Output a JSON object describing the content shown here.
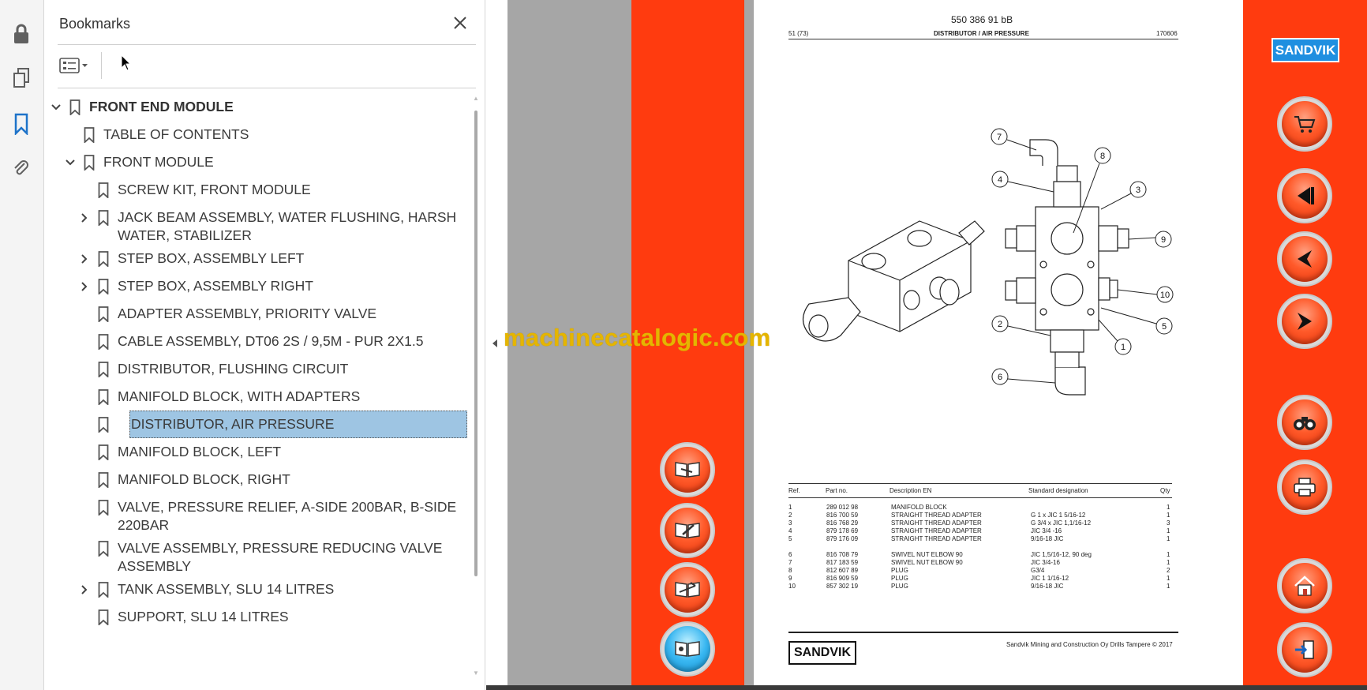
{
  "panel": {
    "title": "Bookmarks",
    "bookmarks": [
      {
        "label": "FRONT END MODULE"
      },
      {
        "label": "TABLE OF CONTENTS"
      },
      {
        "label": "FRONT MODULE"
      },
      {
        "label": "SCREW KIT, FRONT MODULE"
      },
      {
        "label": "JACK BEAM ASSEMBLY, WATER FLUSHING, HARSH",
        "label2": "WATER, STABILIZER"
      },
      {
        "label": "STEP BOX, ASSEMBLY LEFT"
      },
      {
        "label": "STEP BOX, ASSEMBLY RIGHT"
      },
      {
        "label": "ADAPTER ASSEMBLY, PRIORITY VALVE"
      },
      {
        "label": "CABLE ASSEMBLY, DT06 2S / 9,5M - PUR 2X1.5"
      },
      {
        "label": "DISTRIBUTOR, FLUSHING CIRCUIT"
      },
      {
        "label": "MANIFOLD BLOCK, WITH ADAPTERS"
      },
      {
        "label": "DISTRIBUTOR, AIR PRESSURE",
        "selected": true
      },
      {
        "label": "MANIFOLD BLOCK, LEFT"
      },
      {
        "label": "MANIFOLD BLOCK, RIGHT"
      },
      {
        "label": "VALVE, PRESSURE RELIEF, A-SIDE 200BAR, B-SIDE",
        "label2": "220BAR"
      },
      {
        "label": "VALVE ASSEMBLY, PRESSURE REDUCING VALVE",
        "label2": "ASSEMBLY"
      },
      {
        "label": "TANK ASSEMBLY, SLU 14 LITRES"
      },
      {
        "label": "SUPPORT, SLU 14 LITRES"
      }
    ]
  },
  "watermark": "machinecatalogic.com",
  "brand": "SANDVIK",
  "colors": {
    "strip": "#ff3b0f",
    "selection": "#9ec5e3",
    "watermark": "#e5b500"
  },
  "page": {
    "doc_number": "550 386 91 bB",
    "page_number": "51 (73)",
    "title": "DISTRIBUTOR / AIR PRESSURE",
    "date": "170606",
    "table": {
      "headers": [
        "Ref.",
        "Part no.",
        "Description EN",
        "Standard designation",
        "Qty"
      ],
      "rows": [
        [
          "1",
          "289 012 98",
          "MANIFOLD BLOCK",
          "",
          "1"
        ],
        [
          "2",
          "816 700 59",
          "STRAIGHT THREAD ADAPTER",
          "G 1 x JIC 1 5/16-12",
          "1"
        ],
        [
          "3",
          "816 768 29",
          "STRAIGHT THREAD ADAPTER",
          "G 3/4 x JIC 1,1/16-12",
          "3"
        ],
        [
          "4",
          "879 178 69",
          "STRAIGHT THREAD ADAPTER",
          "JIC 3/4 -16",
          "1"
        ],
        [
          "5",
          "879 176 09",
          "STRAIGHT THREAD ADAPTER",
          "9/16-18 JIC",
          "1"
        ],
        [
          "6",
          "816 708 79",
          "SWIVEL NUT ELBOW 90",
          "JIC 1,5/16-12, 90 deg",
          "1"
        ],
        [
          "7",
          "817 183 59",
          "SWIVEL NUT ELBOW 90",
          "JIC 3/4-16",
          "1"
        ],
        [
          "8",
          "812 607 89",
          "PLUG",
          "G3/4",
          "2"
        ],
        [
          "9",
          "816 909 59",
          "PLUG",
          "JIC 1 1/16-12",
          "1"
        ],
        [
          "10",
          "857 302 19",
          "PLUG",
          "9/16-18 JIC",
          "1"
        ]
      ]
    },
    "callouts": [
      "7",
      "8",
      "4",
      "3",
      "9",
      "10",
      "5",
      "2",
      "1",
      "6"
    ],
    "footer": "Sandvik Mining and Construction Oy Drills Tampere © 2017"
  },
  "left_nav_buttons": [
    {
      "icon": "book-hand-icon"
    },
    {
      "icon": "book-pencil-icon"
    },
    {
      "icon": "book-edit-icon"
    },
    {
      "icon": "book-open-icon"
    }
  ],
  "right_nav_buttons": [
    {
      "icon": "cart-icon"
    },
    {
      "icon": "first-page-icon"
    },
    {
      "icon": "prev-page-icon"
    },
    {
      "icon": "next-page-icon"
    },
    {
      "icon": "binoculars-icon"
    },
    {
      "icon": "printer-icon"
    },
    {
      "icon": "home-icon"
    },
    {
      "icon": "exit-icon"
    }
  ]
}
